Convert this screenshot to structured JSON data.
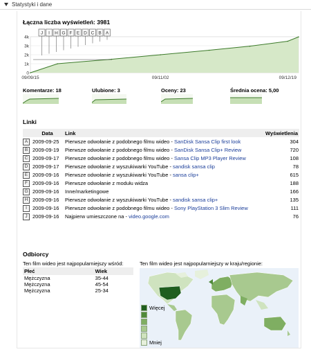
{
  "panel": {
    "title": "Statystyki i dane"
  },
  "views_total": {
    "label": "Łączna liczba wyświetleń: 3981"
  },
  "chart_data": {
    "type": "area",
    "title": "",
    "xlabel": "",
    "ylabel": "",
    "x_tick_labels": [
      "09/09/15",
      "09/11/02",
      "09/12/19"
    ],
    "y_tick_labels": [
      "0",
      "1k",
      "2k",
      "3k",
      "4k"
    ],
    "ylim": [
      0,
      4000
    ],
    "series": [
      {
        "x": [
          "2009-09-15",
          "2009-09-25",
          "2009-10-15",
          "2009-11-02",
          "2009-11-20",
          "2009-12-05",
          "2009-12-19",
          "2009-12-23"
        ],
        "values": [
          0,
          1000,
          1500,
          2000,
          2500,
          2950,
          3500,
          3981
        ]
      }
    ],
    "markers": [
      "J",
      "I",
      "H",
      "G",
      "F",
      "E",
      "D",
      "C",
      "B",
      "A"
    ]
  },
  "mini_stats": [
    {
      "label": "Komentarze: 18",
      "color": "#6aa84f"
    },
    {
      "label": "Ulubione: 3",
      "color": "#6aa84f"
    },
    {
      "label": "Oceny: 23",
      "color": "#6aa84f"
    },
    {
      "label": "Średnia ocena: 5,00",
      "color": "#6aa84f"
    }
  ],
  "links": {
    "title": "Linki",
    "headers": {
      "date": "Data",
      "link": "Link",
      "views": "Wyświetlenia"
    },
    "rows": [
      {
        "marker": "A",
        "date": "2009-09-25",
        "text": "Pierwsze odwołanie z podobnego filmu wideo - ",
        "link": "SanDisk Sansa Clip first look",
        "views": "304"
      },
      {
        "marker": "B",
        "date": "2009-09-19",
        "text": "Pierwsze odwołanie z podobnego filmu wideo - ",
        "link": "SanDisk Sansa Clip+ Review",
        "views": "720"
      },
      {
        "marker": "C",
        "date": "2009-09-17",
        "text": "Pierwsze odwołanie z podobnego filmu wideo - ",
        "link": "Sansa Clip MP3 Player Review",
        "views": "108"
      },
      {
        "marker": "D",
        "date": "2009-09-17",
        "text": "Pierwsze odwołanie z wyszukiwarki YouTube - ",
        "link": "sandisk sansa clip",
        "views": "78"
      },
      {
        "marker": "E",
        "date": "2009-09-16",
        "text": "Pierwsze odwołanie z wyszukiwarki YouTube - ",
        "link": "sansa clip+",
        "views": "615"
      },
      {
        "marker": "F",
        "date": "2009-09-16",
        "text": "Pierwsze odwołanie z modułu widza",
        "link": "",
        "views": "188"
      },
      {
        "marker": "G",
        "date": "2009-09-16",
        "text": "Inne/marketingowe",
        "link": "",
        "views": "166"
      },
      {
        "marker": "H",
        "date": "2009-09-16",
        "text": "Pierwsze odwołanie z wyszukiwarki YouTube - ",
        "link": "sandisk sansa clip+",
        "views": "135"
      },
      {
        "marker": "I",
        "date": "2009-09-16",
        "text": "Pierwsze odwołanie z podobnego filmu wideo - ",
        "link": "Sony PlayStation 3 Slim Review",
        "views": "111"
      },
      {
        "marker": "J",
        "date": "2009-09-16",
        "text": "Najpierw umieszczone na - ",
        "link": "video.google.com",
        "views": "76"
      }
    ]
  },
  "audience": {
    "title": "Odbiorcy",
    "subtitle": "Ten film wideo jest najpopularniejszy wśród:",
    "headers": {
      "gender": "Płeć",
      "age": "Wiek"
    },
    "rows": [
      {
        "gender": "Mężczyzna",
        "age": "35-44"
      },
      {
        "gender": "Mężczyzna",
        "age": "45-54"
      },
      {
        "gender": "Mężczyzna",
        "age": "25-34"
      }
    ]
  },
  "geo": {
    "subtitle": "Ten film wideo jest najpopularniejszy w kraju/regionie:",
    "legend_more": "Więcej",
    "legend_less": "Mniej",
    "colors": [
      "#1f5e1f",
      "#4f8a3a",
      "#7fae62",
      "#a8c98f",
      "#cfe3bf",
      "#e6f0dc"
    ]
  }
}
